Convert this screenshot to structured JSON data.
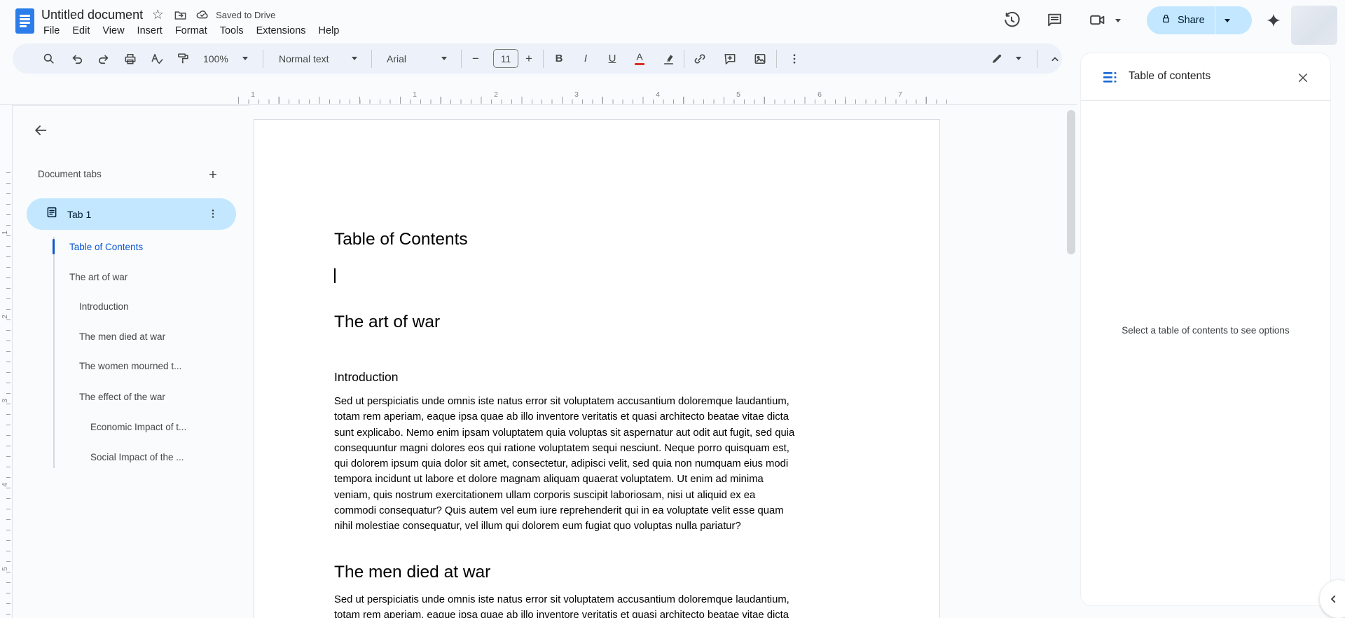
{
  "header": {
    "title": "Untitled document",
    "saved_status": "Saved to Drive",
    "menus": {
      "file": "File",
      "edit": "Edit",
      "view": "View",
      "insert": "Insert",
      "format": "Format",
      "tools": "Tools",
      "extensions": "Extensions",
      "help": "Help"
    },
    "share_label": "Share"
  },
  "toolbar": {
    "zoom_value": "100%",
    "styles_value": "Normal text",
    "font_value": "Arial",
    "font_size_value": "11"
  },
  "ruler": {
    "h": [
      "1",
      "1",
      "2",
      "3",
      "4",
      "5",
      "6",
      "7"
    ],
    "v": [
      "1",
      "2",
      "3",
      "4",
      "5"
    ]
  },
  "sidebar": {
    "section_title": "Document tabs",
    "tab_label": "Tab 1",
    "outline": [
      {
        "label": "Table of Contents",
        "level": 1,
        "active": true
      },
      {
        "label": "The art of war",
        "level": 1,
        "active": false
      },
      {
        "label": "Introduction",
        "level": 2,
        "active": false
      },
      {
        "label": "The men died at war",
        "level": 2,
        "active": false
      },
      {
        "label": "The women mourned t...",
        "level": 2,
        "active": false
      },
      {
        "label": "The effect of the war",
        "level": 2,
        "active": false
      },
      {
        "label": "Economic Impact of t...",
        "level": 3,
        "active": false
      },
      {
        "label": "Social Impact of the ...",
        "level": 3,
        "active": false
      }
    ]
  },
  "document": {
    "heading_toc": "Table of Contents",
    "heading_art": "The art of war",
    "heading_intro": "Introduction",
    "heading_men": "The men died at war",
    "para1_lines": [
      "Sed ut perspiciatis unde omnis iste natus error sit voluptatem accusantium doloremque laudantium,",
      "totam rem aperiam, eaque ipsa quae ab illo inventore veritatis et quasi architecto beatae vitae dicta",
      "sunt explicabo. Nemo enim ipsam voluptatem quia voluptas sit aspernatur aut odit aut fugit, sed quia",
      "consequuntur magni dolores eos qui ratione voluptatem sequi nesciunt. Neque porro quisquam est,",
      "qui dolorem ipsum quia dolor sit amet, consectetur, adipisci velit, sed quia non numquam eius modi",
      "tempora incidunt ut labore et dolore magnam aliquam quaerat voluptatem. Ut enim ad minima",
      "veniam, quis nostrum exercitationem ullam corporis suscipit laboriosam, nisi ut aliquid ex ea",
      "commodi consequatur? Quis autem vel eum iure reprehenderit qui in ea voluptate velit esse quam",
      "nihil molestiae consequatur, vel illum qui dolorem eum fugiat quo voluptas nulla pariatur?"
    ],
    "para2_lines": [
      "Sed ut perspiciatis unde omnis iste natus error sit voluptatem accusantium doloremque laudantium,",
      "totam rem aperiam, eaque ipsa quae ab illo inventore veritatis et quasi architecto beatae vitae dicta"
    ]
  },
  "panel": {
    "title": "Table of contents",
    "empty_message": "Select a table of contents to see options"
  },
  "colors": {
    "accent_blue": "#0b57d0",
    "selection_blue": "#c2e7ff",
    "toolbar_bg": "#edf2fa",
    "app_bg": "#f9fbfd",
    "icon_gray": "#444746",
    "text_color_indicator": "#d93025",
    "ruler_marker_blue": "#4285f4"
  }
}
